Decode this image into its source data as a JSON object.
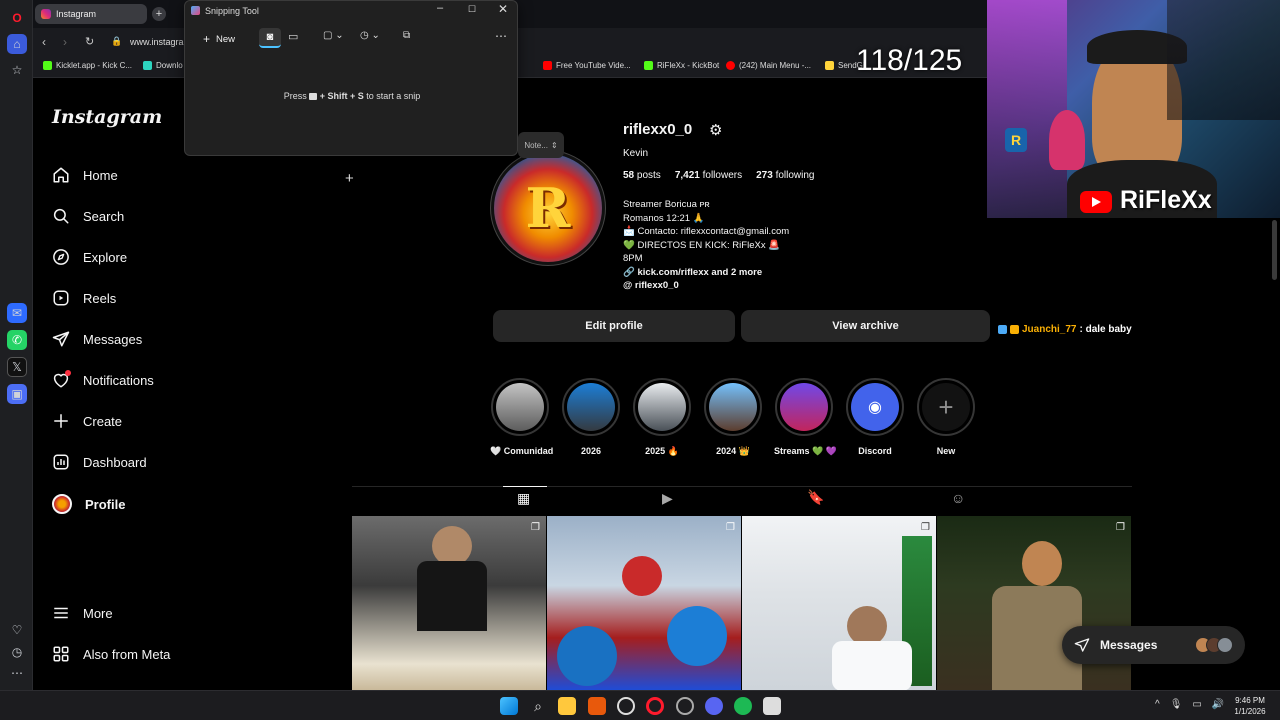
{
  "browser": {
    "active_tab": "Instagram",
    "address": "www.instagram",
    "bookmarks": [
      "Kicklet.app - Kick C...",
      "Downlo",
      "Free YouTube Vide...",
      "RiFleXx - KickBot",
      "(242) Main Menu -...",
      "SendGi"
    ],
    "colors": {
      "opera_red": "#ff1b2d"
    }
  },
  "snipping_tool": {
    "title": "Snipping Tool",
    "new_label": "New",
    "hint_prefix": "Press",
    "hint_keys": "+ Shift + S",
    "hint_suffix": "to start a snip",
    "notes_label": "Note..."
  },
  "instagram": {
    "logo": "Instagram",
    "nav": [
      {
        "label": "Home",
        "icon": "home-icon"
      },
      {
        "label": "Search",
        "icon": "search-icon"
      },
      {
        "label": "Explore",
        "icon": "compass-icon"
      },
      {
        "label": "Reels",
        "icon": "reels-icon"
      },
      {
        "label": "Messages",
        "icon": "send-icon"
      },
      {
        "label": "Notifications",
        "icon": "heart-icon"
      },
      {
        "label": "Create",
        "icon": "plus-icon"
      },
      {
        "label": "Dashboard",
        "icon": "dashboard-icon"
      },
      {
        "label": "Profile",
        "icon": "avatar-icon"
      }
    ],
    "more_label": "More",
    "meta_label": "Also from Meta",
    "profile": {
      "username": "riflexx0_0",
      "name": "Kevin",
      "posts_count": "58",
      "posts_word": "posts",
      "followers_count": "7,421",
      "followers_word": "followers",
      "following_count": "273",
      "following_word": "following",
      "bio_line1": "Streamer Boricua ᴘʀ",
      "bio_line2": "Romanos 12:21 🙏",
      "bio_line3": "📩 Contacto: riflexxcontact@gmail.com",
      "bio_line4": "💚 DIRECTOS EN KICK: RiFleXx 🚨",
      "bio_line5": "8PM",
      "link": "kick.com/riflexx and 2 more",
      "threads": "riflexx0_0"
    },
    "edit_profile": "Edit profile",
    "view_archive": "View archive",
    "highlights": [
      "🤍 Comunidad",
      "2026",
      "2025 🔥",
      "2024 👑",
      "Streams 💚 💜",
      "Discord",
      "New"
    ],
    "messages_pill": "Messages"
  },
  "stream": {
    "counter": "118/125",
    "channel": "RiFleXx",
    "chat_user": "Juanchi_77",
    "chat_msg": ": dale baby"
  },
  "taskbar": {
    "time": "9:46 PM",
    "date": "1/1/2026"
  }
}
